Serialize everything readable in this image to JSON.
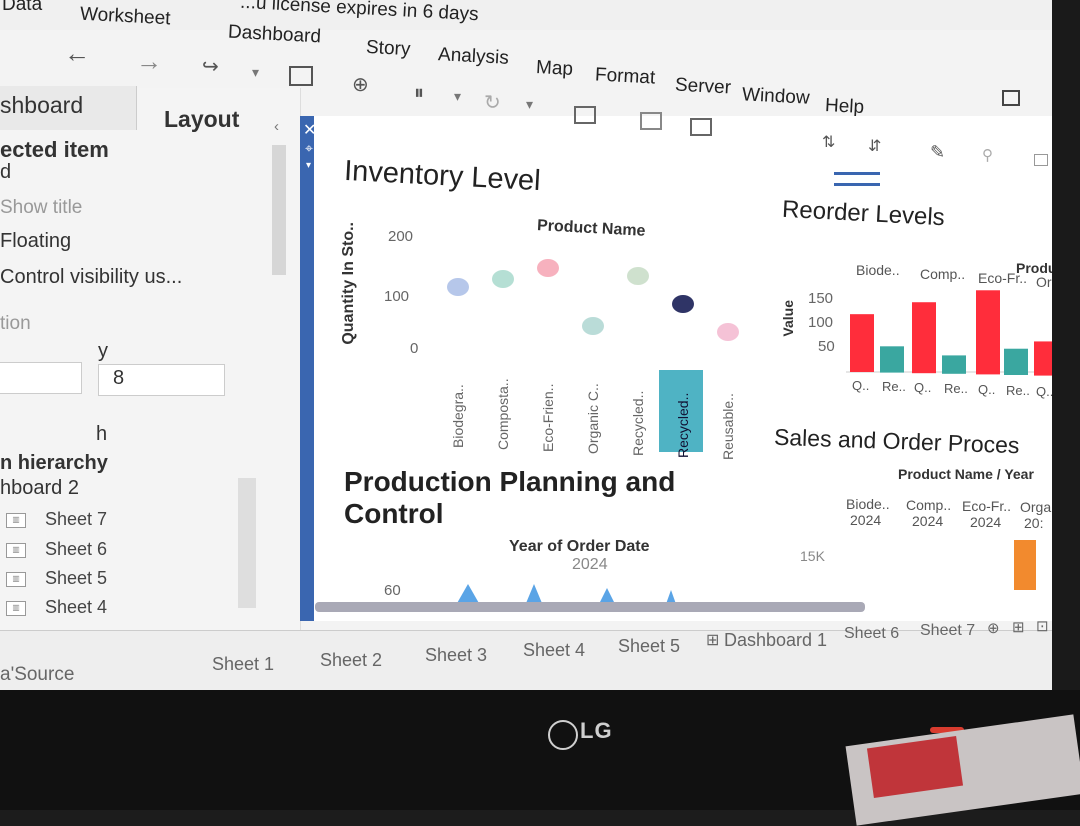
{
  "menu": {
    "items": [
      "Data",
      "Worksheet",
      "Dashboard",
      "Story",
      "Analysis",
      "Map",
      "Format",
      "Server",
      "Window",
      "Help"
    ],
    "license_notice": "...u license expires in 6 days"
  },
  "left_panel": {
    "tabs": [
      "shboard",
      "Layout"
    ],
    "selected_item_header": "ected item",
    "selected_item_value": "d",
    "options": [
      "Show title",
      "Floating",
      "Control visibility us..."
    ],
    "position_label": "tion",
    "y_label": "y",
    "y_value": "8",
    "h_label": "h",
    "hierarchy_header": "n hierarchy",
    "hierarchy_root": "hboard 2",
    "sheets": [
      "Sheet 7",
      "Sheet 6",
      "Sheet 5",
      "Sheet 4"
    ]
  },
  "dashboard": {
    "inventory": {
      "title": "Inventory Level",
      "legend_title": "Product Name",
      "y_axis_label": "Quantity In Sto..",
      "y_ticks": [
        "200",
        "100",
        "0"
      ]
    },
    "reorder": {
      "title": "Reorder Levels",
      "header_right": "Produc",
      "y_axis_label": "Value",
      "y_ticks": [
        "150",
        "100",
        "50"
      ],
      "groups": [
        "Biode..",
        "Comp..",
        "Eco-Fr..",
        "Org"
      ],
      "x_labels": [
        "Q..",
        "Re..",
        "Q..",
        "Re..",
        "Q..",
        "Re..",
        "Q.."
      ]
    },
    "sales": {
      "title": "Sales and Order Proces",
      "header": "Product Name / Year",
      "columns": [
        {
          "name": "Biode..",
          "year": "2024"
        },
        {
          "name": "Comp..",
          "year": "2024"
        },
        {
          "name": "Eco-Fr..",
          "year": "2024"
        },
        {
          "name": "Orga",
          "year": "20:"
        }
      ],
      "y_tick": "15K"
    },
    "production": {
      "title_line1": "Production Planning and",
      "title_line2": "Control",
      "header": "Year of Order Date",
      "year": "2024",
      "y_tick": "60"
    }
  },
  "bottom_tabs": {
    "source": "a'Source",
    "sheets": [
      "Sheet 1",
      "Sheet 2",
      "Sheet 3",
      "Sheet 4",
      "Sheet 5",
      "Dashboard 1",
      "Sheet 6",
      "Sheet 7"
    ]
  },
  "brand": "LG",
  "chart_data": [
    {
      "type": "scatter",
      "title": "Inventory Level",
      "legend_title": "Product Name",
      "ylabel": "Quantity In Sto..",
      "ylim": [
        0,
        200
      ],
      "categories": [
        "Biodegra..",
        "Composta..",
        "Eco-Frien..",
        "Organic C..",
        "Recycled..",
        "Recycled..",
        "Reusable.."
      ],
      "values": [
        105,
        125,
        150,
        60,
        150,
        110,
        70
      ],
      "colors": [
        "#a9bde6",
        "#a8d9cc",
        "#f6a3b3",
        "#aed6d1",
        "#c7dcc6",
        "#2f3466",
        "#f3b7cf"
      ],
      "highlighted_category_index": 5,
      "highlight_color": "#4fb3c4"
    },
    {
      "type": "bar",
      "title": "Reorder Levels",
      "ylabel": "Value",
      "ylim": [
        0,
        175
      ],
      "categories": [
        "Q..",
        "Re..",
        "Q..",
        "Re..",
        "Q..",
        "Re..",
        "Q.."
      ],
      "groups": [
        "Biode..",
        "Biode..",
        "Comp..",
        "Comp..",
        "Eco-Fr..",
        "Eco-Fr..",
        "Org"
      ],
      "values": [
        110,
        50,
        135,
        35,
        160,
        50,
        65
      ],
      "colors": [
        "#ff2d3b",
        "#3aa7a0",
        "#ff2d3b",
        "#3aa7a0",
        "#ff2d3b",
        "#3aa7a0",
        "#ff2d3b"
      ]
    }
  ]
}
